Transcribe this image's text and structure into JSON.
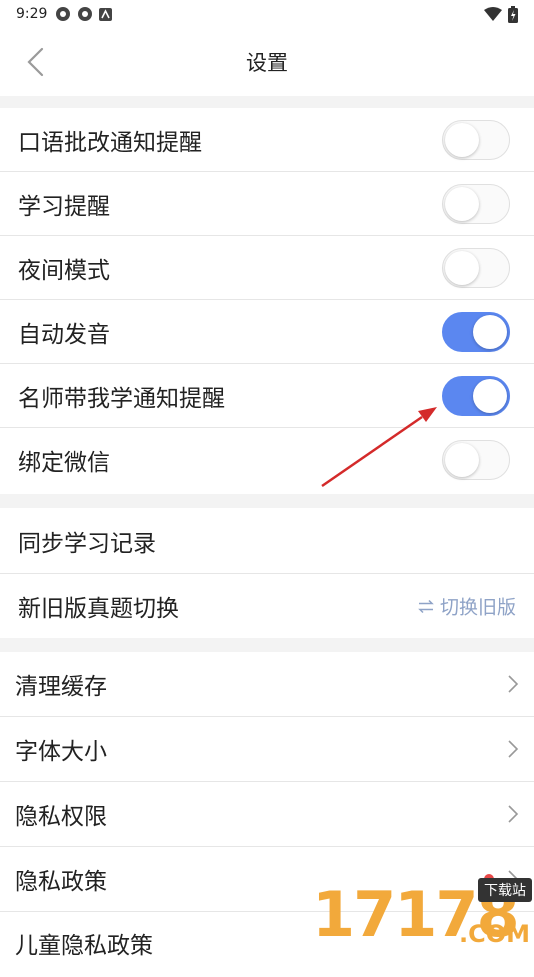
{
  "status_bar": {
    "time": "9:29"
  },
  "nav": {
    "title": "设置"
  },
  "toggles": [
    {
      "label": "口语批改通知提醒",
      "on": false
    },
    {
      "label": "学习提醒",
      "on": false
    },
    {
      "label": "夜间模式",
      "on": false
    },
    {
      "label": "自动发音",
      "on": true
    },
    {
      "label": "名师带我学通知提醒",
      "on": true
    },
    {
      "label": "绑定微信",
      "on": false
    }
  ],
  "section2": {
    "sync": "同步学习记录",
    "version_switch": "新旧版真题切换",
    "version_action": "切换旧版"
  },
  "section3": [
    {
      "label": "清理缓存"
    },
    {
      "label": "字体大小"
    },
    {
      "label": "隐私权限"
    },
    {
      "label": "隐私政策",
      "badge": true
    },
    {
      "label": "儿童隐私政策"
    }
  ],
  "watermark": {
    "digits": "17178",
    "tag": "下载站",
    "suffix": ".COM"
  },
  "colors": {
    "toggle_on": "#5b87f0",
    "arrow": "#d42a2a",
    "badge": "#e84848"
  }
}
